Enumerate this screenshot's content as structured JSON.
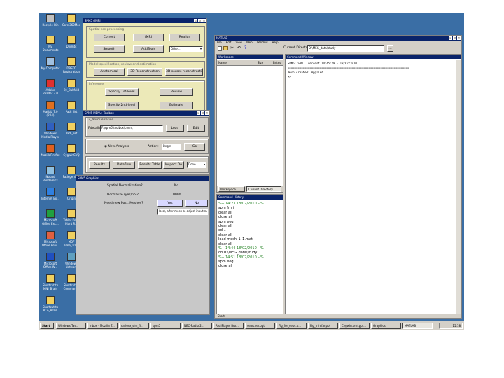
{
  "desktop_icons": [
    {
      "label": "Recycle Bin",
      "icon": "recycle-bin-icon"
    },
    {
      "label": "Corel360Moe",
      "icon": "folder-icon"
    },
    {
      "label": "My Documents",
      "icon": "documents-icon"
    },
    {
      "label": "Dhrmtc",
      "icon": "folder-icon"
    },
    {
      "label": "My Computer",
      "icon": "computer-icon"
    },
    {
      "label": "DBSTC Registration",
      "icon": "folder-icon"
    },
    {
      "label": "Adobe Reader 7.0",
      "icon": "pdf-icon"
    },
    {
      "label": "By_Bakfold",
      "icon": "folder-icon"
    },
    {
      "label": "Matlab 7.0 (R14)",
      "icon": "matlab-icon"
    },
    {
      "label": "Path_list",
      "icon": "folder-icon"
    },
    {
      "label": "Windows Media Player",
      "icon": "media-player-icon"
    },
    {
      "label": "Path_list",
      "icon": "folder-icon"
    },
    {
      "label": "MozillaFirefox",
      "icon": "firefox-icon"
    },
    {
      "label": "CygwinCVQ",
      "icon": "folder-icon"
    },
    {
      "label": "Nopad Pandemics",
      "icon": "notepad-icon"
    },
    {
      "label": "Padegen002",
      "icon": "folder-icon"
    },
    {
      "label": "Internet Ex...",
      "icon": "ie-icon"
    },
    {
      "label": "Origin",
      "icon": "folder-icon"
    },
    {
      "label": "Microsoft Office Exc...",
      "icon": "excel-icon"
    },
    {
      "label": "Tablet Dock Plant R...",
      "icon": "folder-icon"
    },
    {
      "label": "Microsoft Office Pow...",
      "icon": "powerpoint-icon"
    },
    {
      "label": "MDF Time_1000",
      "icon": "folder-icon"
    },
    {
      "label": "Microsoft Office W...",
      "icon": "word-icon"
    },
    {
      "label": "Windows Network",
      "icon": "network-icon"
    },
    {
      "label": "Shortcut to MNI_Brain",
      "icon": "shortcut-icon"
    },
    {
      "label": "Shortcut to Commands",
      "icon": "shortcut-icon"
    },
    {
      "label": "Shortcut to PCA_Brain",
      "icon": "shortcut-icon"
    }
  ],
  "spm_menu": {
    "title": "SPM5 (fMRI)",
    "sections": [
      "Spatial pre-processing",
      "Model specification, review and estimation",
      "Inference"
    ],
    "buttons": [
      "Correct",
      "fMRI",
      "Realign",
      "Smooth",
      "AddTools",
      "Other...",
      "Anatomical",
      "3D Reconstruction",
      "3D source reconstruction",
      "Specify 1st-level",
      "Review",
      "Specify 2nd-level",
      "Estimate"
    ]
  },
  "conn_toolbox": {
    "title": "SPM5 MENU: Toolbox",
    "section_label": "3_Normalisation",
    "path_label": "Fdetails:",
    "path_value": "F:\\spm5\\toolbox\\conn\\",
    "load_label": "Load",
    "edit_label": "Edit",
    "radio_label": "New Analysis",
    "action_label": "Action:",
    "action_value": "Begin",
    "go_label": "Go",
    "tabs": [
      "Results",
      "Dataflow",
      "Results Table",
      "Inspect DA"
    ],
    "dropdown_value": "Done"
  },
  "options_panel": {
    "title": "SPM5 Graphics",
    "rows": [
      {
        "label": "Spatial Normalization?",
        "value": "No"
      },
      {
        "label": "Normalize (yes/no)?",
        "value": "0000"
      },
      {
        "label": "Need new Post. Meshes?",
        "value": ""
      }
    ],
    "yes_label": "Yes",
    "no_label": "No",
    "hint": "lb(s), after mesh to adjust input mats"
  },
  "matlab": {
    "title": "MATLAB",
    "menu": [
      "File",
      "Edit",
      "View",
      "Web",
      "Window",
      "Help"
    ],
    "current_directory_label": "Current Directory:",
    "current_directory_value": "D:\\MEG_data\\study",
    "workspace_title": "Workspace",
    "workspace_columns": [
      "Name",
      "Size",
      "Bytes"
    ],
    "tabs": [
      "Workspace",
      "Current Directory"
    ],
    "command_history_title": "Command History",
    "history_lines": [
      "%-- 14:23 18/02/2010 --%",
      "spm fmri",
      "clear all",
      "close all",
      "spm eeg",
      "clear all",
      "cd ..",
      "clear all",
      "load mesh_1_1.mat",
      "clear all",
      "%-- 14:44 18/02/2010 --%",
      "cd D:\\MEG_data\\study",
      "%-- 14:51 18/02/2010 --%",
      "spm eeg",
      "close all"
    ],
    "command_window_title": "Command Window",
    "command_lines": [
      "SPM5: SPM  ..reconst                                   14:45:29 - 18/02/2010",
      "========================================================================",
      "Mesh created: Applied",
      ">>"
    ],
    "status": "Start"
  },
  "taskbar": {
    "start_label": "Start",
    "tasks": [
      "Windows Tas...",
      "Inbox - Mozilla T...",
      "carlosx_sim_fi...",
      "spm5",
      "NEC-Radio 2...",
      "RealPlayer Bro...",
      "searcher.pgt",
      "Fig_for_cebs.p...",
      "Fig_trfrcfar.ppt",
      "Cygwin.pmf.ppt...",
      "Graphics",
      "MATLAB"
    ],
    "active_task": "MATLAB",
    "clock": "15:18"
  },
  "colors": {
    "desktop": "#3a6ea5",
    "titlebar": "#0a246a",
    "face": "#d4d0c8",
    "spm_panel": "#ece9b8"
  }
}
